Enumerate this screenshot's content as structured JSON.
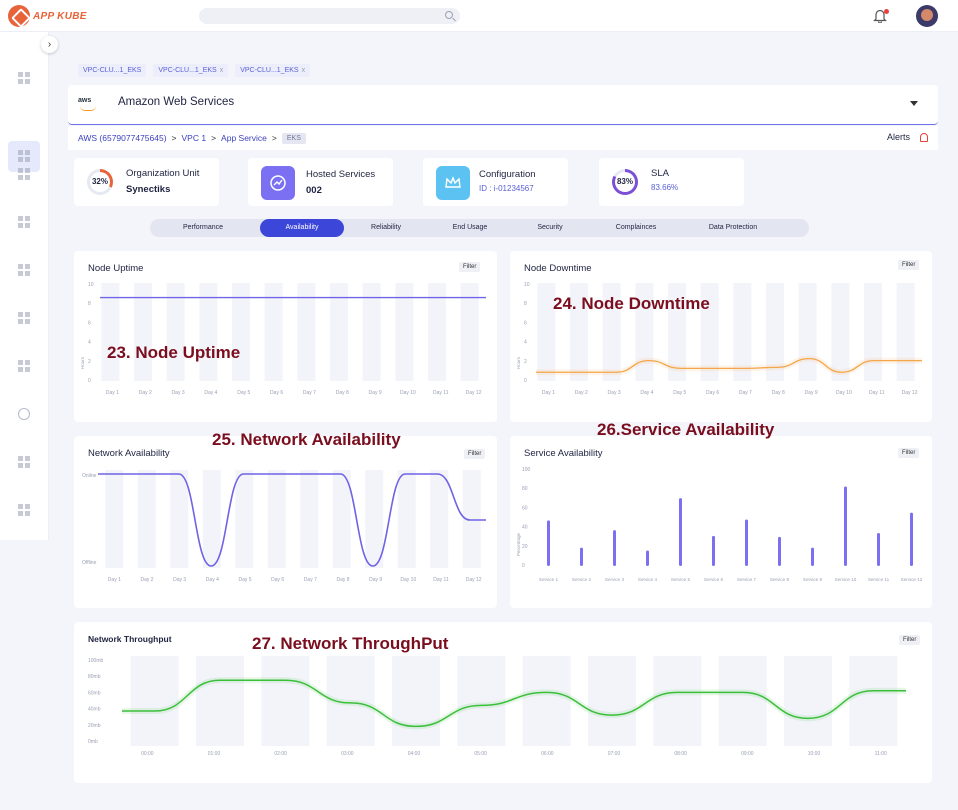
{
  "app": {
    "name": "APP KUBE"
  },
  "tabs": [
    {
      "label": "VPC-CLU...1_EKS",
      "closable": false
    },
    {
      "label": "VPC-CLU...1_EKS",
      "closable": true
    },
    {
      "label": "VPC-CLU...1_EKS",
      "closable": true
    }
  ],
  "close_glyph": "x",
  "provider": {
    "logo_text": "aws",
    "name": "Amazon Web Services"
  },
  "breadcrumb": {
    "items": [
      "AWS (6579077475645)",
      "VPC 1",
      "App Service"
    ],
    "current": "EKS",
    "separator": ">"
  },
  "alerts": {
    "label": "Alerts"
  },
  "kpis": [
    {
      "ring": "32%",
      "label": "Organization Unit",
      "value": "Synectiks",
      "ring_color": "#e8623a"
    },
    {
      "label": "Hosted Services",
      "value": "002",
      "icon_color": "#7b6ff2"
    },
    {
      "label": "Configuration",
      "value": "ID : i-01234567",
      "icon_color": "#5cc2f2"
    },
    {
      "ring": "83%",
      "label": "SLA",
      "value": "83.66%",
      "ring_color": "#7b4fd6"
    }
  ],
  "segments": [
    "Performance",
    "Availability",
    "Reliability",
    "End Usage",
    "Security",
    "Complainces",
    "Data Protection"
  ],
  "active_segment": "Availability",
  "filter_label": "Filter",
  "days": [
    "Day 1",
    "Day 2",
    "Day 3",
    "Day 4",
    "Day 5",
    "Day 6",
    "Day 7",
    "Day 8",
    "Day 9",
    "Day 10",
    "Day 11",
    "Day 12"
  ],
  "services": [
    "Service 1",
    "Service 2",
    "Service 3",
    "Service 4",
    "Service 5",
    "Service 6",
    "Service 7",
    "Service 8",
    "Service 9",
    "Service 10",
    "Service 11",
    "Service 12"
  ],
  "times": [
    "00:00",
    "01:00",
    "02:00",
    "03:00",
    "04:00",
    "05:00",
    "06:00",
    "07:00",
    "08:00",
    "09:00",
    "10:00",
    "11:00"
  ],
  "panels": {
    "node_uptime": {
      "title": "Node Uptime",
      "annotation": "23. Node Uptime",
      "ylabel": "Hours",
      "y_ticks": [
        "10",
        "8",
        "6",
        "4",
        "2",
        "0"
      ]
    },
    "node_downtime": {
      "title": "Node Downtime",
      "annotation": "24. Node Downtime",
      "ylabel": "Hours",
      "y_ticks": [
        "10",
        "8",
        "6",
        "4",
        "2",
        "0"
      ]
    },
    "network_availability": {
      "title": "Network Availability",
      "annotation": "25. Network Availability",
      "y_ticks": [
        "Online",
        "Offline"
      ]
    },
    "service_availability": {
      "title": "Service Availability",
      "annotation": "26.Service Availability",
      "ylabel": "Percentage",
      "y_ticks": [
        "100",
        "80",
        "60",
        "40",
        "20",
        "0"
      ]
    },
    "network_throughput": {
      "title": "Network Throughput",
      "annotation": "27. Network ThroughPut",
      "y_ticks": [
        "100mb",
        "80mb",
        "60mb",
        "40mb",
        "20mb",
        "0mb"
      ]
    }
  },
  "chart_data": [
    {
      "type": "line",
      "title": "Node Uptime",
      "ylabel": "Hours",
      "x": [
        "Day 1",
        "Day 2",
        "Day 3",
        "Day 4",
        "Day 5",
        "Day 6",
        "Day 7",
        "Day 8",
        "Day 9",
        "Day 10",
        "Day 11",
        "Day 12"
      ],
      "ylim": [
        0,
        10
      ],
      "series": [
        {
          "values": [
            8.5,
            8.5,
            8.5,
            8.5,
            8.5,
            8.5,
            8.5,
            8.5,
            8.5,
            8.5,
            8.5,
            8.5
          ],
          "color": "#6f63e6"
        }
      ]
    },
    {
      "type": "line",
      "title": "Node Downtime",
      "ylabel": "Hours",
      "x": [
        "Day 1",
        "Day 2",
        "Day 3",
        "Day 4",
        "Day 5",
        "Day 6",
        "Day 7",
        "Day 8",
        "Day 9",
        "Day 10",
        "Day 11",
        "Day 12"
      ],
      "ylim": [
        0,
        10
      ],
      "series": [
        {
          "values": [
            0.8,
            0.8,
            0.8,
            2,
            1.2,
            1.2,
            1.2,
            1.3,
            2.2,
            0.8,
            2,
            2
          ],
          "color": "#f4a64a"
        }
      ]
    },
    {
      "type": "line",
      "title": "Network Availability",
      "x": [
        "Day 1",
        "Day 2",
        "Day 3",
        "Day 4",
        "Day 5",
        "Day 6",
        "Day 7",
        "Day 8",
        "Day 9",
        "Day 10",
        "Day 11",
        "Day 12"
      ],
      "ylim": [
        0,
        1
      ],
      "series": [
        {
          "values": [
            1,
            1,
            1,
            0,
            1,
            1,
            1,
            1,
            0,
            1,
            1,
            0.5
          ],
          "color": "#6f63e6"
        }
      ]
    },
    {
      "type": "bar",
      "title": "Service Availability",
      "ylabel": "Percentage",
      "categories": [
        "Service 1",
        "Service 2",
        "Service 3",
        "Service 4",
        "Service 5",
        "Service 6",
        "Service 7",
        "Service 8",
        "Service 9",
        "Service 10",
        "Service 11",
        "Service 12"
      ],
      "ylim": [
        0,
        100
      ],
      "values": [
        47,
        19,
        37,
        16,
        70,
        31,
        48,
        30,
        19,
        82,
        34,
        55
      ],
      "color": "#7b6ff2"
    },
    {
      "type": "line",
      "title": "Network Throughput",
      "x": [
        "00:00",
        "01:00",
        "02:00",
        "03:00",
        "04:00",
        "05:00",
        "06:00",
        "07:00",
        "08:00",
        "09:00",
        "10:00",
        "11:00"
      ],
      "ylim": [
        0,
        100
      ],
      "series": [
        {
          "values": [
            37,
            75,
            75,
            47,
            18,
            44,
            60,
            32,
            60,
            60,
            28,
            62
          ],
          "color": "#3bbf3b"
        }
      ]
    }
  ]
}
